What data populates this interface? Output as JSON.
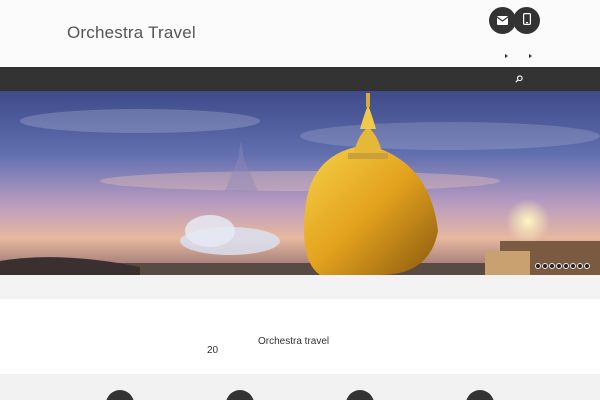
{
  "header": {
    "site_title": "Orchestra Travel",
    "contact_icons": [
      "envelope-icon",
      "phone-icon"
    ]
  },
  "nav": {
    "search_icon": "search-icon"
  },
  "hero": {
    "description": "",
    "slider_dot_count": 8
  },
  "intro": {
    "heading": "Orchestra travel",
    "number": "20"
  },
  "features": {
    "count": 4
  },
  "colors": {
    "dark": "#333333",
    "header_bg": "#fbfbfb",
    "footer_bg": "#f2f2f2"
  }
}
